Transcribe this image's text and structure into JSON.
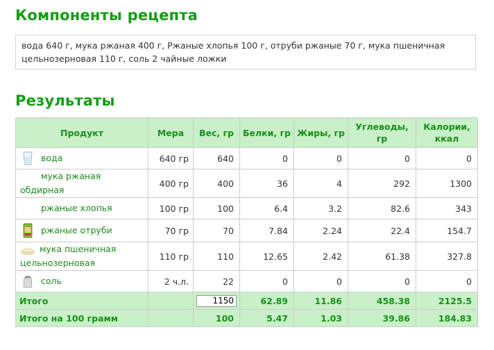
{
  "headings": {
    "components": "Компоненты рецепта",
    "results": "Результаты"
  },
  "recipe_text": "вода 640 г, мука ржаная 400 г, Ржаные хлопья 100 г, отруби ржаные 70 г, мука пшеничная цельнозерновая 110 г, соль 2 чайные ложки",
  "table": {
    "headers": {
      "product": "Продукт",
      "measure": "Мера",
      "weight": "Вес, гр",
      "protein": "Белки, гр",
      "fat": "Жиры, гр",
      "carbs": "Углеводы, гр",
      "calories": "Калории, ккал"
    },
    "rows": [
      {
        "product": "вода",
        "icon": "water-glass-icon",
        "measure": "640 гр",
        "weight": "640",
        "protein": "0",
        "fat": "0",
        "carbs": "0",
        "calories": "0"
      },
      {
        "product": "мука ржаная обдирная",
        "icon": "",
        "measure": "400 гр",
        "weight": "400",
        "protein": "36",
        "fat": "4",
        "carbs": "292",
        "calories": "1300"
      },
      {
        "product": "ржаные хлопья",
        "icon": "",
        "measure": "100 гр",
        "weight": "100",
        "protein": "6.4",
        "fat": "3.2",
        "carbs": "82.6",
        "calories": "343"
      },
      {
        "product": "ржаные отруби",
        "icon": "bran-pack-icon",
        "measure": "70 гр",
        "weight": "70",
        "protein": "7.84",
        "fat": "2.24",
        "carbs": "22.4",
        "calories": "154.7"
      },
      {
        "product": "мука пшеничная цельнозерновая",
        "icon": "flour-pile-icon",
        "measure": "110 гр",
        "weight": "110",
        "protein": "12.65",
        "fat": "2.42",
        "carbs": "61.38",
        "calories": "327.8"
      },
      {
        "product": "соль",
        "icon": "salt-shaker-icon",
        "measure": "2 ч.л.",
        "weight": "22",
        "protein": "0",
        "fat": "0",
        "carbs": "0",
        "calories": "0"
      }
    ],
    "total": {
      "label": "Итого",
      "weight_input": "1150",
      "protein": "62.89",
      "fat": "11.86",
      "carbs": "458.38",
      "calories": "2125.5"
    },
    "per100": {
      "label": "Итого на 100 грамм",
      "weight": "100",
      "protein": "5.47",
      "fat": "1.03",
      "carbs": "39.86",
      "calories": "184.83"
    }
  },
  "colors": {
    "heading_green": "#129d12",
    "header_bg": "#c9f0c9",
    "link_green": "#1d8a1d"
  }
}
